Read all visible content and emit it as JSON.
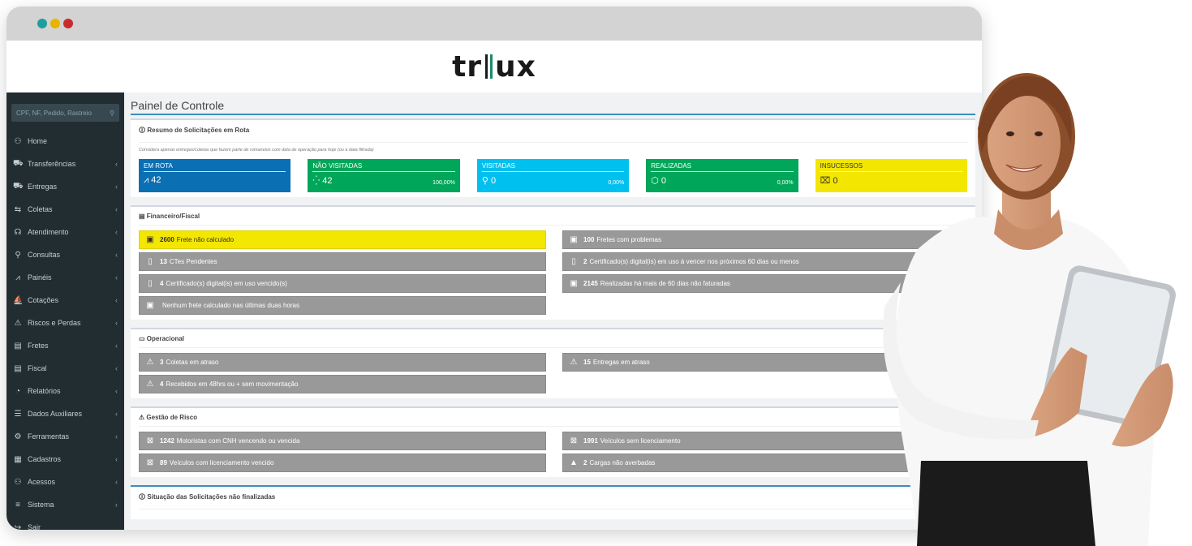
{
  "window": {
    "controls": [
      "#1f9e9e",
      "#e8b400",
      "#c82b2b"
    ]
  },
  "logo": {
    "prefix": "tr",
    "suffix": "ux",
    "accent_color": "#1a8a6a"
  },
  "sidebar": {
    "search_placeholder": "CPF, NF, Pedido, Rastreio",
    "items": [
      {
        "label": "Home",
        "icon": "⚇",
        "chevron": ""
      },
      {
        "label": "Transferências",
        "icon": "⛟",
        "chevron": "‹"
      },
      {
        "label": "Entregas",
        "icon": "⛟",
        "chevron": "‹"
      },
      {
        "label": "Coletas",
        "icon": "⇆",
        "chevron": "‹"
      },
      {
        "label": "Atendimento",
        "icon": "☊",
        "chevron": "‹"
      },
      {
        "label": "Consultas",
        "icon": "⚲",
        "chevron": "‹"
      },
      {
        "label": "Painéis",
        "icon": "⩘",
        "chevron": "‹"
      },
      {
        "label": "Cotações",
        "icon": "⛵",
        "chevron": "‹"
      },
      {
        "label": "Riscos e Perdas",
        "icon": "⚠",
        "chevron": "‹"
      },
      {
        "label": "Fretes",
        "icon": "▤",
        "chevron": "‹"
      },
      {
        "label": "Fiscal",
        "icon": "▤",
        "chevron": "‹"
      },
      {
        "label": "Relatórios",
        "icon": "◔",
        "chevron": "‹"
      },
      {
        "label": "Dados Auxiliares",
        "icon": "☰",
        "chevron": "‹"
      },
      {
        "label": "Ferramentas",
        "icon": "⚙",
        "chevron": "‹"
      },
      {
        "label": "Cadastros",
        "icon": "▦",
        "chevron": "‹"
      },
      {
        "label": "Acessos",
        "icon": "⚇",
        "chevron": "‹"
      },
      {
        "label": "Sistema",
        "icon": "≡",
        "chevron": "‹"
      },
      {
        "label": "Sair",
        "icon": "↪",
        "chevron": ""
      }
    ]
  },
  "page": {
    "title": "Painel de Controle"
  },
  "resumo": {
    "title": "Resumo de Solicitações em Rota",
    "note": "Considera apenas entregas/coletas que fazem parte de romaneios com data de operação para hoje (ou a data filtrada)",
    "stats": [
      {
        "label": "EM ROTA",
        "icon": "⩘",
        "value": "42",
        "pct": "",
        "color": "#0b6fb3"
      },
      {
        "label": "NÃO VISITADAS",
        "icon": "⁛",
        "value": "42",
        "pct": "100,00%",
        "color": "#00a65a"
      },
      {
        "label": "VISITADAS",
        "icon": "⚲",
        "value": "0",
        "pct": "0,00%",
        "color": "#00c0ef"
      },
      {
        "label": "REALIZADAS",
        "icon": "⬡",
        "value": "0",
        "pct": "0,00%",
        "color": "#00a65a"
      },
      {
        "label": "INSUCESSOS",
        "icon": "⌧",
        "value": "0",
        "pct": "",
        "color": "#f3e600"
      }
    ]
  },
  "financeiro": {
    "title": "Financeiro/Fiscal",
    "alerts": [
      {
        "count": "2600",
        "text": "Frete não calculado",
        "icon": "▣",
        "style": "yellow"
      },
      {
        "count": "100",
        "text": "Fretes com problemas",
        "icon": "▣",
        "style": "gray"
      },
      {
        "count": "13",
        "text": "CTes Pendentes",
        "icon": "▯",
        "style": "gray"
      },
      {
        "count": "2",
        "text": "Certificado(s) digital(is) em uso à vencer nos próximos 60 dias ou menos",
        "icon": "▯",
        "style": "gray"
      },
      {
        "count": "4",
        "text": "Certificado(s) digital(is) em uso vencido(s)",
        "icon": "▯",
        "style": "gray"
      },
      {
        "count": "2145",
        "text": "Realizadas há mais de 60 dias não faturadas",
        "icon": "▣",
        "style": "gray"
      },
      {
        "count": "",
        "text": "Nenhum frete calculado nas últimas duas horas",
        "icon": "▣",
        "style": "gray"
      }
    ]
  },
  "operacional": {
    "title": "Operacional",
    "alerts": [
      {
        "count": "3",
        "text": "Coletas em atraso",
        "icon": "⚠"
      },
      {
        "count": "15",
        "text": "Entregas em atraso",
        "icon": "⚠"
      },
      {
        "count": "4",
        "text": "Recebidos em 48hrs ou + sem movimentação",
        "icon": "⚠"
      }
    ]
  },
  "risco": {
    "title": "Gestão de Risco",
    "alerts": [
      {
        "count": "1242",
        "text": "Motoristas com CNH vencendo ou vencida",
        "icon": "⊠"
      },
      {
        "count": "1991",
        "text": "Veículos sem licenciamento",
        "icon": "⊠"
      },
      {
        "count": "89",
        "text": "Veículos com licenciamento vencido",
        "icon": "⊠"
      },
      {
        "count": "2",
        "text": "Cargas não averbadas",
        "icon": "▲"
      }
    ]
  },
  "situacao": {
    "title": "Situação das Solicitações não finalizadas"
  }
}
